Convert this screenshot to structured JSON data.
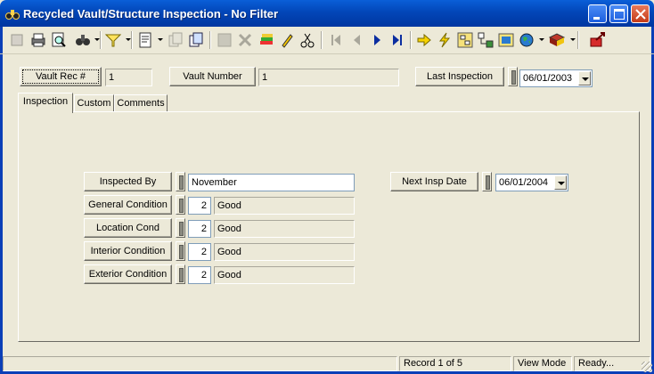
{
  "window": {
    "title": "Recycled Vault/Structure Inspection - No Filter",
    "icon": "binoculars-app-icon",
    "controls": [
      "minimize",
      "maximize",
      "close"
    ]
  },
  "toolbar": {
    "icons": [
      "new-record-icon",
      "print-icon",
      "print-preview-icon",
      "binoculars-find-icon",
      "filter-icon",
      "report-icon",
      "copy-disabled-icon",
      "copy-icon",
      "save-disabled-icon",
      "delete-disabled-icon",
      "stack-icon",
      "pencil-edit-icon",
      "cut-icon",
      "first-record-icon",
      "previous-record-icon",
      "next-record-icon",
      "last-record-icon",
      "goto-arrow-icon",
      "lightning-icon",
      "tree-icon",
      "structure-icon",
      "map-icon",
      "globe-icon",
      "book-icon",
      "exit-icon"
    ]
  },
  "header": {
    "vault_rec_label": "Vault Rec #",
    "vault_rec_value": "1",
    "vault_number_label": "Vault Number",
    "vault_number_value": "1",
    "last_inspection_label": "Last Inspection",
    "last_inspection_value": "06/01/2003"
  },
  "tabs": [
    {
      "label": "Inspection",
      "active": true
    },
    {
      "label": "Custom",
      "active": false
    },
    {
      "label": "Comments",
      "active": false
    }
  ],
  "form": {
    "inspected_by_label": "Inspected By",
    "inspected_by_value": "November",
    "next_insp_label": "Next Insp Date",
    "next_insp_value": "06/01/2004",
    "conditions": [
      {
        "label": "General Condition",
        "code": "2",
        "text": "Good"
      },
      {
        "label": "Location Cond",
        "code": "2",
        "text": "Good"
      },
      {
        "label": "Interior Condition",
        "code": "2",
        "text": "Good"
      },
      {
        "label": "Exterior Condition",
        "code": "2",
        "text": "Good"
      }
    ]
  },
  "status": {
    "record": "Record 1 of 5",
    "mode": "View Mode",
    "state": "Ready..."
  },
  "colors": {
    "titlebar": "#0246b8",
    "face": "#ece9d8",
    "close": "#c43b18"
  }
}
